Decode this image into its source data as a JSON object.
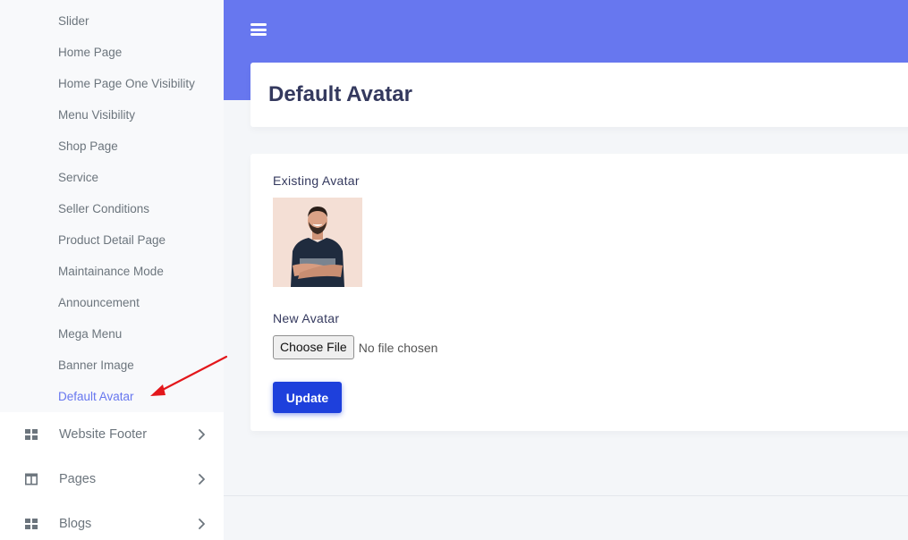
{
  "sidebar": {
    "submenu_items": [
      {
        "label": "Slider"
      },
      {
        "label": "Home Page"
      },
      {
        "label": "Home Page One Visibility"
      },
      {
        "label": "Menu Visibility"
      },
      {
        "label": "Shop Page"
      },
      {
        "label": "Service"
      },
      {
        "label": "Seller Conditions"
      },
      {
        "label": "Product Detail Page"
      },
      {
        "label": "Maintainance Mode"
      },
      {
        "label": "Announcement"
      },
      {
        "label": "Mega Menu"
      },
      {
        "label": "Banner Image"
      },
      {
        "label": "Default Avatar",
        "active": true
      }
    ],
    "menu_items": [
      {
        "label": "Website Footer",
        "icon": "grid-icon"
      },
      {
        "label": "Pages",
        "icon": "columns-icon"
      },
      {
        "label": "Blogs",
        "icon": "grid-icon"
      }
    ]
  },
  "header": {
    "title": "Default Avatar",
    "menu_icon": "hamburger-icon"
  },
  "form": {
    "existing_label": "Existing Avatar",
    "new_label": "New Avatar",
    "file_button_label": "Choose File",
    "file_status": "No file chosen",
    "submit_label": "Update"
  },
  "colors": {
    "primary": "#6777ef",
    "button": "#1e40dc",
    "annotation_arrow": "#e3171b"
  }
}
